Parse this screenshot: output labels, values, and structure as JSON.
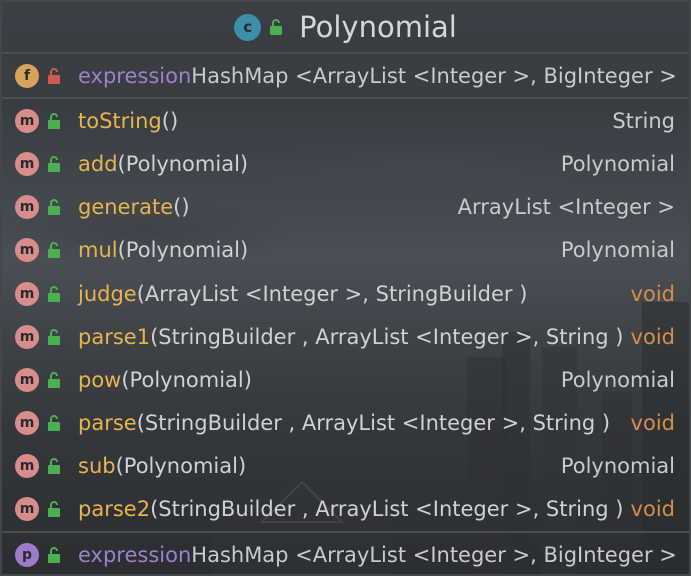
{
  "class": {
    "name": "Polynomial",
    "kind_badge": "c",
    "badge_color": "#3d8ea8"
  },
  "colors": {
    "field_badge": "#d7a35c",
    "method_badge": "#d88c8c",
    "property_badge": "#9b7cc9",
    "public_lock": "#4caf50",
    "private_lock": "#d0584d",
    "method_name": "#e8b44d",
    "field_name": "#9b82c9",
    "void_type": "#d68e47"
  },
  "field": {
    "badge": "f",
    "name": "expression",
    "type": "HashMap <ArrayList <Integer >, BigInteger >"
  },
  "methods": [
    {
      "badge": "m",
      "name": "toString",
      "params": " ()",
      "type": "String"
    },
    {
      "badge": "m",
      "name": "add",
      "params": "(Polynomial)",
      "type": "Polynomial"
    },
    {
      "badge": "m",
      "name": "generate",
      "params": " ()",
      "type": "ArrayList <Integer >"
    },
    {
      "badge": "m",
      "name": "mul",
      "params": "(Polynomial)",
      "type": "Polynomial"
    },
    {
      "badge": "m",
      "name": "judge",
      "params": "(ArrayList <Integer >, StringBuilder )",
      "type": "void"
    },
    {
      "badge": "m",
      "name": "parse1",
      "params": " (StringBuilder , ArrayList <Integer >, String )",
      "type": "void"
    },
    {
      "badge": "m",
      "name": "pow",
      "params": "(Polynomial)",
      "type": "Polynomial"
    },
    {
      "badge": "m",
      "name": "parse",
      "params": "(StringBuilder , ArrayList <Integer >, String )",
      "type": "void"
    },
    {
      "badge": "m",
      "name": "sub",
      "params": "(Polynomial)",
      "type": "Polynomial"
    },
    {
      "badge": "m",
      "name": "parse2",
      "params": " (StringBuilder , ArrayList <Integer >, String )",
      "type": "void"
    }
  ],
  "property": {
    "badge": "p",
    "name": "expression",
    "type": "HashMap <ArrayList <Integer >, BigInteger >"
  }
}
